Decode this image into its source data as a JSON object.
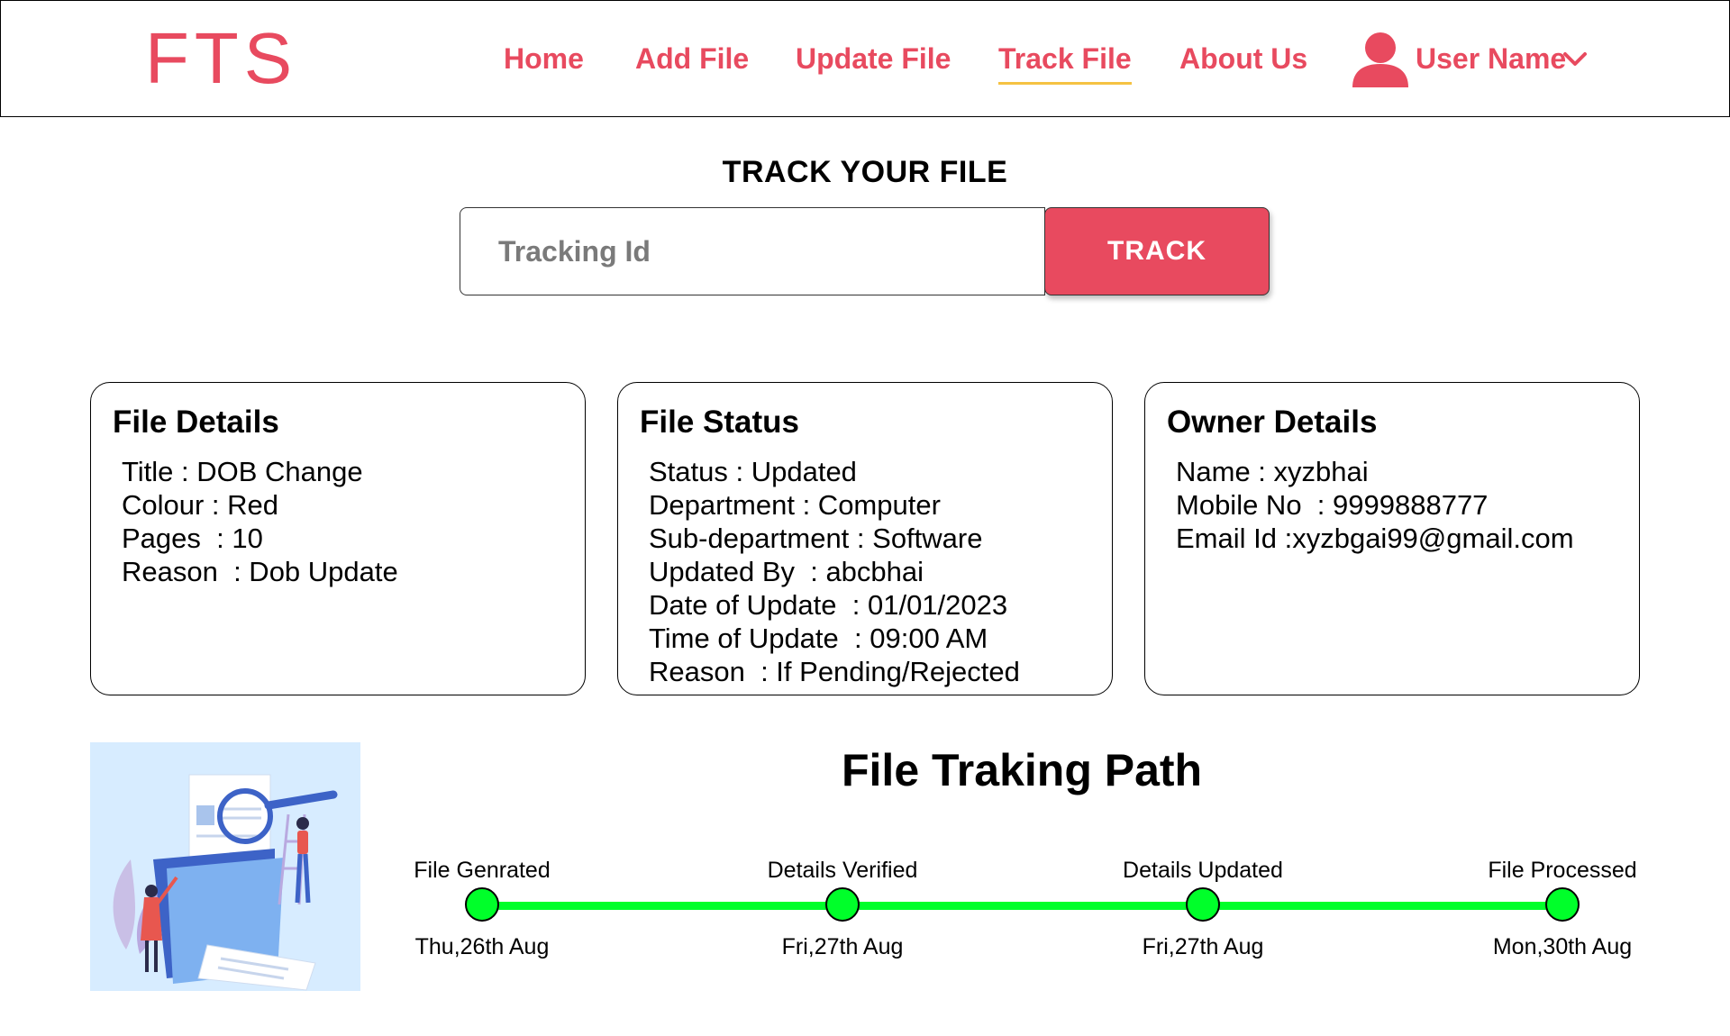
{
  "header": {
    "logo": "FTS",
    "nav": [
      "Home",
      "Add File",
      "Update File",
      "Track File",
      "About Us"
    ],
    "active_nav": "Track File",
    "user_name": "User Name",
    "user_icon": "user-icon",
    "dropdown_icon": "chevron-down-icon"
  },
  "track": {
    "title": "TRACK YOUR FILE",
    "placeholder": "Tracking Id",
    "button": "TRACK"
  },
  "cards": {
    "file_details": {
      "title": "File Details",
      "lines": [
        "Title : DOB Change",
        "Colour : Red",
        "Pages  : 10",
        "Reason  : Dob Update"
      ]
    },
    "file_status": {
      "title": "File Status",
      "lines": [
        "Status : Updated",
        "Department : Computer",
        "Sub-department : Software",
        "Updated By  : abcbhai",
        "Date of Update  : 01/01/2023",
        "Time of Update  : 09:00 AM",
        "Reason  : If Pending/Rejected"
      ]
    },
    "owner_details": {
      "title": "Owner Details",
      "lines": [
        "Name : xyzbhai",
        "Mobile No  : 9999888777",
        "Email Id :xyzbgai99@gmail.com"
      ]
    }
  },
  "path": {
    "title": "File Traking Path",
    "steps": [
      {
        "label": "File Genrated",
        "date": "Thu,26th Aug"
      },
      {
        "label": "Details Verified",
        "date": "Fri,27th Aug"
      },
      {
        "label": "Details Updated",
        "date": "Fri,27th Aug"
      },
      {
        "label": "File Processed",
        "date": "Mon,30th Aug"
      }
    ]
  },
  "colors": {
    "accent": "#e84a5f",
    "underline": "#f5c242",
    "path_green": "#00ff2a"
  }
}
